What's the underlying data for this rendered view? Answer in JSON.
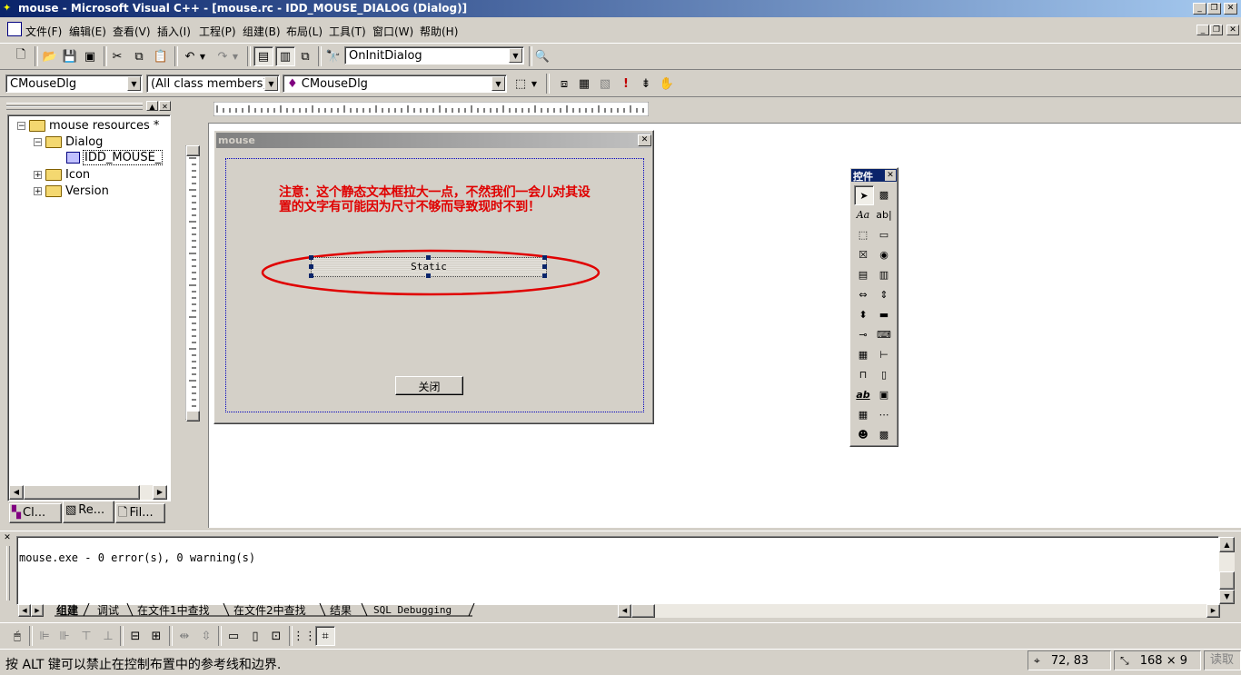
{
  "window": {
    "title": "mouse - Microsoft Visual C++ - [mouse.rc - IDD_MOUSE_DIALOG (Dialog)]"
  },
  "menu": [
    "文件(F)",
    "编辑(E)",
    "查看(V)",
    "插入(I)",
    "工程(P)",
    "组建(B)",
    "布局(L)",
    "工具(T)",
    "窗口(W)",
    "帮助(H)"
  ],
  "toolbar": {
    "function_combo": "OnInitDialog"
  },
  "wizardbar": {
    "class_combo": "CMouseDlg",
    "filter_combo": "(All class members)",
    "members_combo": "CMouseDlg"
  },
  "workspace": {
    "tree": {
      "root": "mouse resources *",
      "dialog_folder": "Dialog",
      "dialog_item": "IDD_MOUSE_",
      "icon_folder": "Icon",
      "version_folder": "Version"
    },
    "tabs": [
      "Cl...",
      "Re...",
      "Fil..."
    ]
  },
  "dialog": {
    "title": "mouse",
    "note": "注意：这个静态文本框拉大一点，不然我们一会儿对其设置的文字有可能因为尺寸不够而导致现时不到！",
    "static_text": "Static",
    "close_button": "关闭"
  },
  "palette": {
    "title": "控件"
  },
  "output": {
    "text": "mouse.exe - 0 error(s), 0 warning(s)",
    "tabs": [
      "组建",
      "调试",
      "在文件1中查找",
      "在文件2中查找",
      "结果",
      "SQL Debugging"
    ]
  },
  "status": {
    "message": "按 ALT 键可以禁止在控制布置中的参考线和边界.",
    "position": "72, 83",
    "size": "168 × 9",
    "mode": "读取"
  },
  "colors": {
    "titlebar_start": "#0a246a",
    "titlebar_end": "#a6caf0",
    "annotation_red": "#e00000",
    "face": "#d4d0c8"
  }
}
